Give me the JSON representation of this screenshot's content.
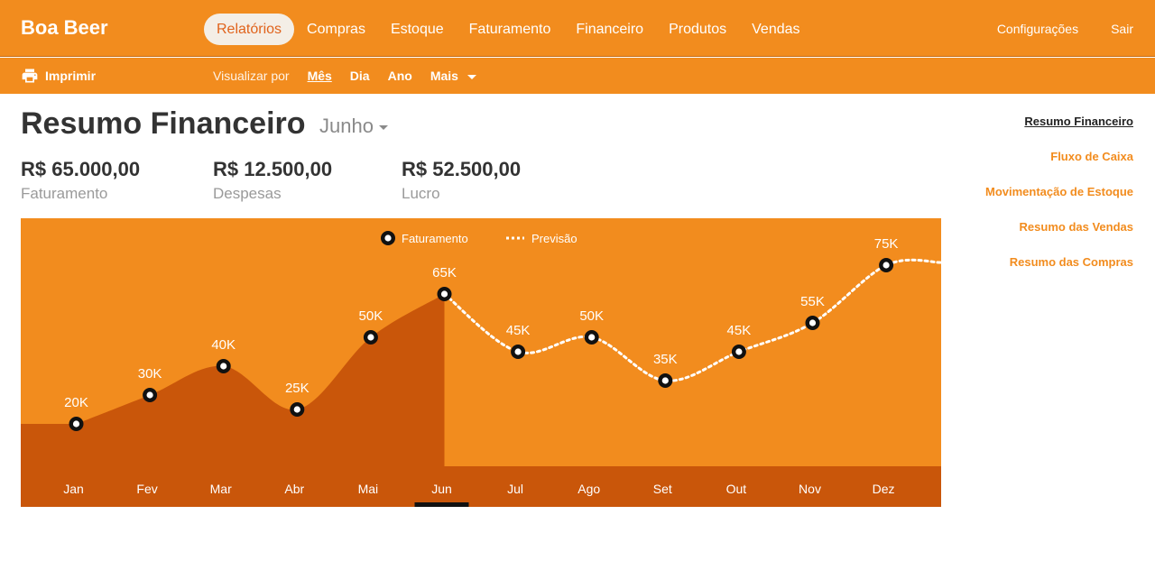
{
  "app": {
    "name": "Boa Beer"
  },
  "nav": {
    "items": [
      "Relatórios",
      "Compras",
      "Estoque",
      "Faturamento",
      "Financeiro",
      "Produtos",
      "Vendas"
    ],
    "active": "Relatórios",
    "settings": "Configurações",
    "logout": "Sair"
  },
  "toolbar": {
    "print": "Imprimir",
    "view_by": "Visualizar por",
    "options": [
      "Mês",
      "Dia",
      "Ano",
      "Mais"
    ],
    "selected": "Mês"
  },
  "report": {
    "title": "Resumo Financeiro",
    "month": "Junho",
    "stats": [
      {
        "value": "R$ 65.000,00",
        "label": "Faturamento"
      },
      {
        "value": "R$ 12.500,00",
        "label": "Despesas"
      },
      {
        "value": "R$ 52.500,00",
        "label": "Lucro"
      }
    ]
  },
  "side_links": [
    "Resumo Financeiro",
    "Fluxo de Caixa",
    "Movimentação de Estoque",
    "Resumo das Vendas",
    "Resumo das Compras"
  ],
  "colors": {
    "brand": "#f28c1e",
    "dark": "#c9560a",
    "axisbar": "#c9560a",
    "text": "#333333"
  },
  "chart_data": {
    "type": "area",
    "categories": [
      "Jan",
      "Fev",
      "Mar",
      "Abr",
      "Mai",
      "Jun",
      "Jul",
      "Ago",
      "Set",
      "Out",
      "Nov",
      "Dez"
    ],
    "series": [
      {
        "name": "Faturamento",
        "values": [
          20,
          30,
          40,
          25,
          50,
          65,
          null,
          null,
          null,
          null,
          null,
          null
        ]
      },
      {
        "name": "Previsão",
        "values": [
          null,
          null,
          null,
          null,
          null,
          65,
          45,
          50,
          35,
          45,
          55,
          75
        ]
      }
    ],
    "data_labels": [
      "20K",
      "30K",
      "40K",
      "25K",
      "50K",
      "65K",
      "45K",
      "50K",
      "35K",
      "45K",
      "55K",
      "75K"
    ],
    "selected_category": "Jun",
    "legend_position": "top-center",
    "grid": false
  }
}
